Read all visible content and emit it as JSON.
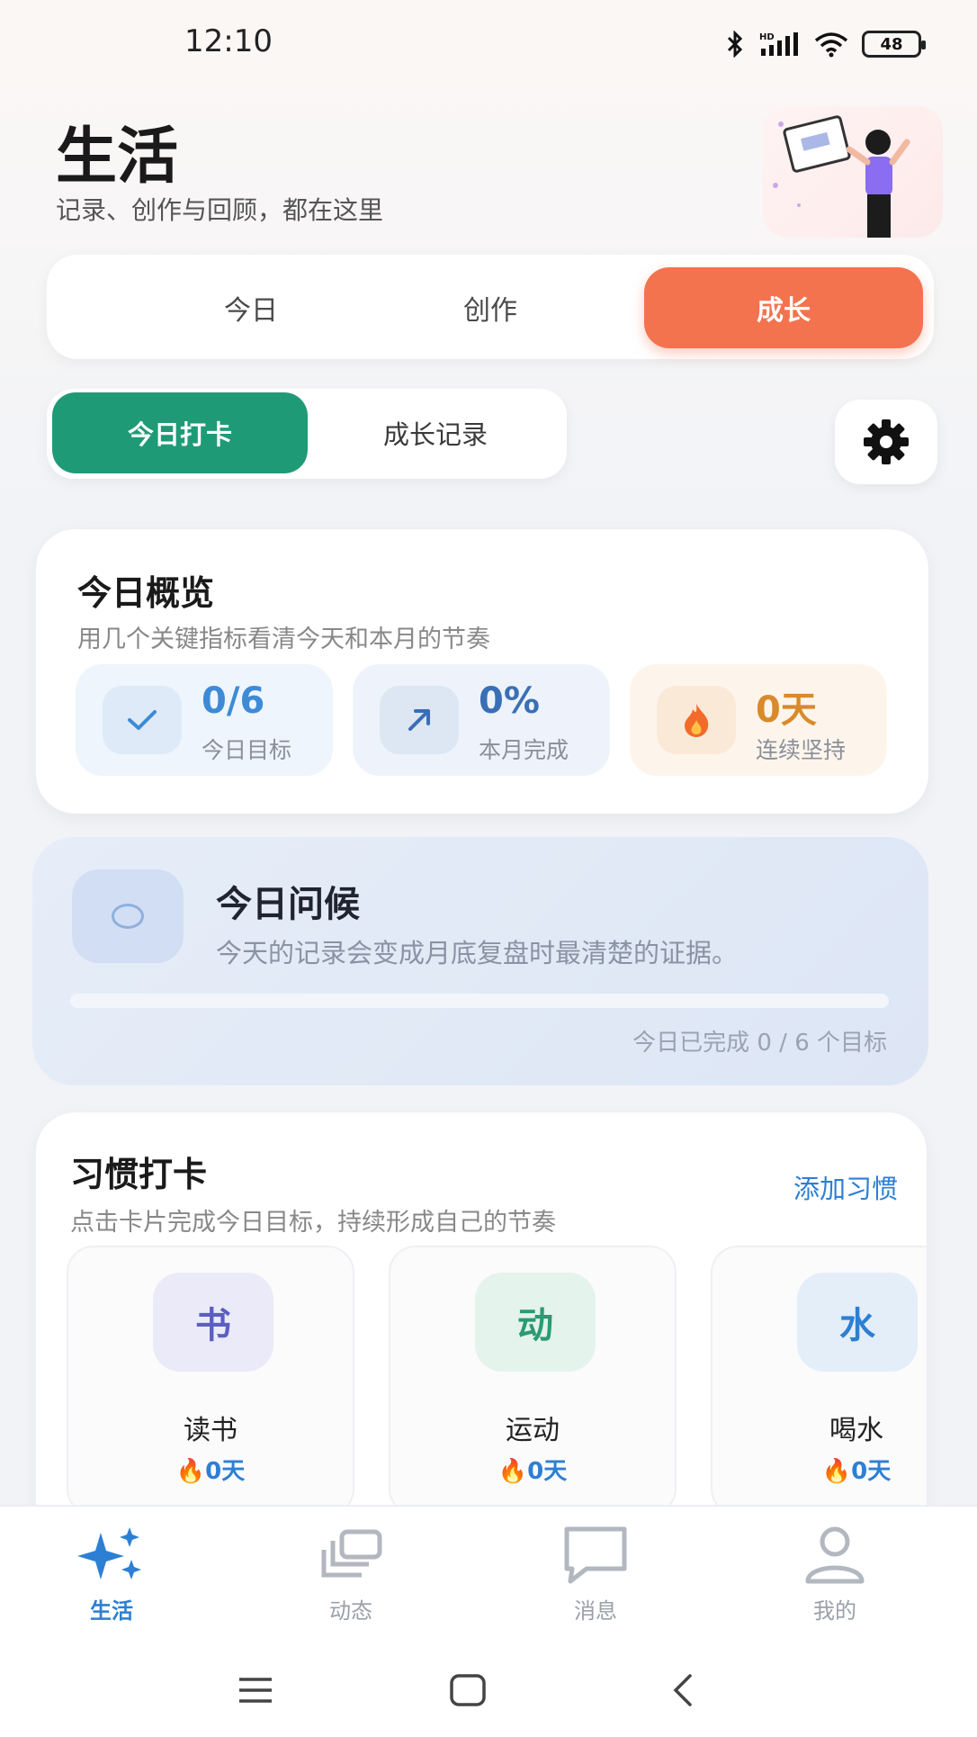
{
  "status_bar": {
    "time": "12:10",
    "battery": "48"
  },
  "header": {
    "title": "生活",
    "subtitle": "记录、创作与回顾，都在这里"
  },
  "main_tabs": [
    {
      "label": "今日"
    },
    {
      "label": "创作"
    },
    {
      "label": "成长",
      "active": true
    }
  ],
  "sub_tabs": [
    {
      "label": "今日打卡",
      "active": true
    },
    {
      "label": "成长记录"
    }
  ],
  "overview": {
    "title": "今日概览",
    "desc": "用几个关键指标看清今天和本月的节奏",
    "metrics": [
      {
        "value": "0/6",
        "label": "今日目标",
        "icon": "check-icon",
        "color": "#3e8ad6"
      },
      {
        "value": "0%",
        "label": "本月完成",
        "icon": "trend-up-icon",
        "color": "#3a6fb5"
      },
      {
        "value": "0天",
        "label": "连续坚持",
        "icon": "fire-icon",
        "color": "#d98a2b"
      }
    ]
  },
  "greeting": {
    "title": "今日问候",
    "text": "今天的记录会变成月底复盘时最清楚的证据。",
    "progress": 0,
    "footer": "今日已完成 0 / 6 个目标"
  },
  "habits": {
    "title": "习惯打卡",
    "desc": "点击卡片完成今日目标，持续形成自己的节奏",
    "add_label": "添加习惯",
    "items": [
      {
        "glyph": "书",
        "name": "读书",
        "streak": "0天",
        "bg": "#ebeaf8",
        "fg": "#5b5fc2"
      },
      {
        "glyph": "动",
        "name": "运动",
        "streak": "0天",
        "bg": "#e4f3ec",
        "fg": "#2c9a72"
      },
      {
        "glyph": "水",
        "name": "喝水",
        "streak": "0天",
        "bg": "#e3eef9",
        "fg": "#2d7fd4"
      }
    ]
  },
  "bottom_nav": [
    {
      "label": "生活",
      "icon": "sparkle-icon",
      "active": true
    },
    {
      "label": "动态",
      "icon": "stack-icon"
    },
    {
      "label": "消息",
      "icon": "chat-icon"
    },
    {
      "label": "我的",
      "icon": "profile-icon"
    }
  ],
  "colors": {
    "accent_orange": "#f3734f",
    "accent_green": "#1f9a77",
    "accent_blue": "#2d7fd4"
  }
}
